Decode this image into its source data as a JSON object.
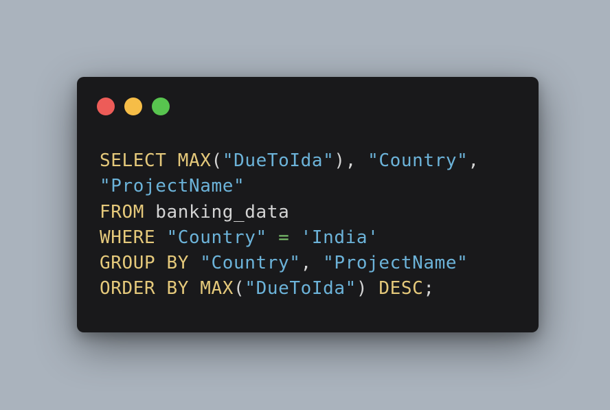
{
  "window": {
    "controls": [
      {
        "name": "close",
        "color": "#ed5c58"
      },
      {
        "name": "minimize",
        "color": "#f6bd47"
      },
      {
        "name": "maximize",
        "color": "#58c44f"
      }
    ]
  },
  "colors": {
    "background": "#aab3bd",
    "panel": "#19191b",
    "keyword": "#e5c97b",
    "string": "#6cb3d9",
    "operator": "#7cc36e",
    "plain": "#d4d4d4"
  },
  "code": {
    "lines": [
      [
        {
          "t": "SELECT ",
          "c": "kw"
        },
        {
          "t": "MAX",
          "c": "kw"
        },
        {
          "t": "(",
          "c": "pl"
        },
        {
          "t": "\"DueToIda\"",
          "c": "str"
        },
        {
          "t": "), ",
          "c": "pl"
        },
        {
          "t": "\"Country\"",
          "c": "str"
        },
        {
          "t": ",",
          "c": "pl"
        }
      ],
      [
        {
          "t": "\"ProjectName\"",
          "c": "str"
        }
      ],
      [
        {
          "t": "FROM ",
          "c": "kw"
        },
        {
          "t": "banking_data",
          "c": "pl"
        }
      ],
      [
        {
          "t": "WHERE ",
          "c": "kw"
        },
        {
          "t": "\"Country\"",
          "c": "str"
        },
        {
          "t": " ",
          "c": "pl"
        },
        {
          "t": "=",
          "c": "op"
        },
        {
          "t": " ",
          "c": "pl"
        },
        {
          "t": "'India'",
          "c": "sq"
        }
      ],
      [
        {
          "t": "GROUP BY ",
          "c": "kw"
        },
        {
          "t": "\"Country\"",
          "c": "str"
        },
        {
          "t": ", ",
          "c": "pl"
        },
        {
          "t": "\"ProjectName\"",
          "c": "str"
        }
      ],
      [
        {
          "t": "ORDER BY ",
          "c": "kw"
        },
        {
          "t": "MAX",
          "c": "kw"
        },
        {
          "t": "(",
          "c": "pl"
        },
        {
          "t": "\"DueToIda\"",
          "c": "str"
        },
        {
          "t": ") ",
          "c": "pl"
        },
        {
          "t": "DESC",
          "c": "kw"
        },
        {
          "t": ";",
          "c": "pl"
        }
      ]
    ]
  }
}
